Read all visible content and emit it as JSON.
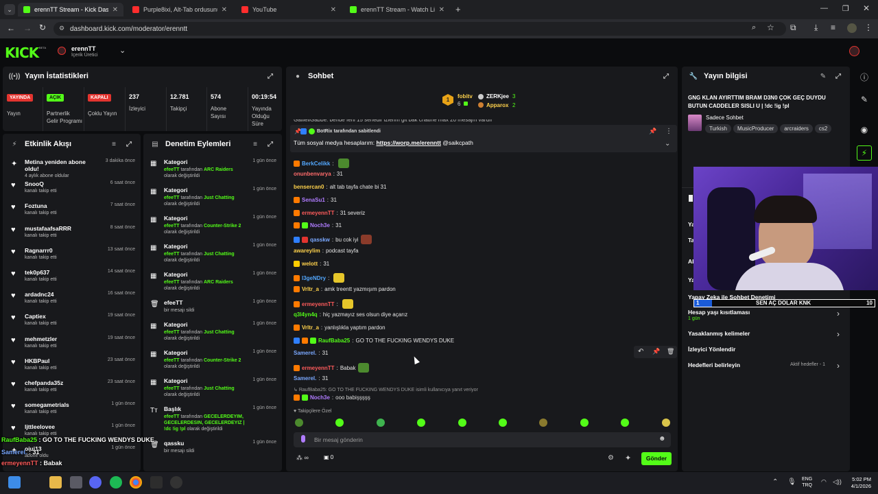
{
  "browser": {
    "tabs": [
      {
        "title": "erennTT Stream - Kick Dashboa",
        "fav": "#53fc18",
        "active": true
      },
      {
        "title": "Purple8ixi, Alt-Tab ordusunu ça",
        "fav": "#ff2d2d",
        "active": false
      },
      {
        "title": "YouTube",
        "fav": "#ff2d2d",
        "active": false
      },
      {
        "title": "erennTT Stream - Watch Live o",
        "fav": "#53fc18",
        "active": false
      }
    ],
    "url": "dashboard.kick.com/moderator/erenntt"
  },
  "header": {
    "logo": "KICK",
    "logo_beta": "BETA",
    "channel_name": "erennTT",
    "channel_role": "İçerik Üretici"
  },
  "stats": {
    "title": "Yayın İstatistikleri",
    "items": [
      {
        "badge": "YAYINDA",
        "badge_color": "#e3342f",
        "label": "Yayın"
      },
      {
        "badge": "AÇIK",
        "badge_color": "#53fc18",
        "label": "Partnerlik Gelir Programı"
      },
      {
        "badge": "KAPALI",
        "badge_color": "#e3342f",
        "label": "Çoklu Yayın"
      }
    ],
    "numbers": [
      {
        "value": "237",
        "label": "İzleyici"
      },
      {
        "value": "12.781",
        "label": "Takipçi"
      },
      {
        "value": "574",
        "label": "Abone Sayısı"
      },
      {
        "value": "00:19:54",
        "label": "Yayında Olduğu Süre"
      }
    ]
  },
  "activity": {
    "title": "Etkinlik Akışı",
    "rows": [
      {
        "name": "Metina yeniden abone oldu!",
        "sub": "4 aylık abone oldular",
        "time": "3 dakika önce",
        "icon": "star-icon"
      },
      {
        "name": "SnooQ",
        "sub": "kanalı takip etti",
        "time": "6 saat önce",
        "icon": "heart-icon"
      },
      {
        "name": "Foztuna",
        "sub": "kanalı takip etti",
        "time": "7 saat önce",
        "icon": "heart-icon"
      },
      {
        "name": "mustafaafsaRRR",
        "sub": "kanalı takip etti",
        "time": "8 saat önce",
        "icon": "heart-icon"
      },
      {
        "name": "Ragnarrr0",
        "sub": "kanalı takip etti",
        "time": "13 saat önce",
        "icon": "heart-icon"
      },
      {
        "name": "tek0p637",
        "sub": "kanalı takip etti",
        "time": "14 saat önce",
        "icon": "heart-icon"
      },
      {
        "name": "ardadnc24",
        "sub": "kanalı takip etti",
        "time": "16 saat önce",
        "icon": "heart-icon"
      },
      {
        "name": "Captiex",
        "sub": "kanalı takip etti",
        "time": "19 saat önce",
        "icon": "heart-icon"
      },
      {
        "name": "mehmetzler",
        "sub": "kanalı takip etti",
        "time": "19 saat önce",
        "icon": "heart-icon"
      },
      {
        "name": "HKBPaul",
        "sub": "kanalı takip etti",
        "time": "23 saat önce",
        "icon": "heart-icon"
      },
      {
        "name": "chefpanda35z",
        "sub": "kanalı takip etti",
        "time": "23 saat önce",
        "icon": "heart-icon"
      },
      {
        "name": "somegametrials",
        "sub": "kanalı takip etti",
        "time": "1 gün önce",
        "icon": "heart-icon"
      },
      {
        "name": "ljttleelovee",
        "sub": "kanalı takip etti",
        "time": "1 gün önce",
        "icon": "heart-icon"
      },
      {
        "name": "oiui13",
        "sub": "abone oldu",
        "time": "1 gün önce",
        "icon": "star-icon"
      }
    ]
  },
  "modlog": {
    "title": "Denetim Eylemleri",
    "rows": [
      {
        "title": "Kategori",
        "user": "efeeTT",
        "mid": " tarafından ",
        "obj": "ARC Raiders",
        "tail": " olarak değiştirildi",
        "time": "1 gün önce",
        "icon": "category-icon"
      },
      {
        "title": "Kategori",
        "user": "efeeTT",
        "mid": " tarafından ",
        "obj": "Just Chatting",
        "tail": " olarak değiştirildi",
        "time": "1 gün önce",
        "icon": "category-icon"
      },
      {
        "title": "Kategori",
        "user": "efeeTT",
        "mid": " tarafından ",
        "obj": "Counter-Strike 2",
        "tail": " olarak değiştirildi",
        "time": "1 gün önce",
        "icon": "category-icon"
      },
      {
        "title": "Kategori",
        "user": "efeeTT",
        "mid": " tarafından ",
        "obj": "Just Chatting",
        "tail": " olarak değiştirildi",
        "time": "1 gün önce",
        "icon": "category-icon"
      },
      {
        "title": "Kategori",
        "user": "efeeTT",
        "mid": " tarafından ",
        "obj": "ARC Raiders",
        "tail": " olarak değiştirildi",
        "time": "1 gün önce",
        "icon": "category-icon"
      },
      {
        "title": "efeeTT",
        "user": "",
        "mid": "bir mesajı sildi",
        "obj": "",
        "tail": "",
        "time": "1 gün önce",
        "icon": "trash-icon"
      },
      {
        "title": "Kategori",
        "user": "efeeTT",
        "mid": " tarafından ",
        "obj": "Just Chatting",
        "tail": " olarak değiştirildi",
        "time": "1 gün önce",
        "icon": "category-icon"
      },
      {
        "title": "Kategori",
        "user": "efeeTT",
        "mid": " tarafından ",
        "obj": "Counter-Strike 2",
        "tail": " olarak değiştirildi",
        "time": "1 gün önce",
        "icon": "category-icon"
      },
      {
        "title": "Kategori",
        "user": "efeeTT",
        "mid": " tarafından ",
        "obj": "Just Chatting",
        "tail": " olarak değiştirildi",
        "time": "1 gün önce",
        "icon": "category-icon"
      },
      {
        "title": "Başlık",
        "user": "efeeTT",
        "mid": " tarafından ",
        "obj": "GECELERDEYIM, GECELERDESIN, GECELERDEYIZ | !dc !ig !pl",
        "tail": " olarak değiştirildi",
        "time": "1 gün önce",
        "icon": "title-icon"
      },
      {
        "title": "qassku",
        "user": "",
        "mid": "bir mesajı sildi",
        "obj": "",
        "tail": "",
        "time": "1 gün önce",
        "icon": "trash-icon"
      }
    ]
  },
  "chat": {
    "title": "Sohbet",
    "top_gifters": [
      {
        "name": "fobitv",
        "count": "6"
      },
      {
        "name": "ZERKjee",
        "count": "3"
      },
      {
        "name": "Apparox",
        "count": "2"
      }
    ],
    "cut_line": "GalileliGabbe: bende ferii 15 senedir izlerim git bak chatine max 20 mesajm vardır",
    "pinned_by": "BotRix tarafından sabitlendi",
    "pinned_text": "Tüm sosyal medya hesaplarım: ",
    "pinned_link": "https://worp.me/erenntt",
    "pinned_tail": " @saikcpath",
    "messages": [
      {
        "user": "BerkCelikk",
        "color": "#53a8ff",
        "text": "",
        "emote": "#4c8a2e",
        "badges": [
          "#ff7a00"
        ]
      },
      {
        "user": "onunbenvarya",
        "color": "#ff6b6b",
        "text": "31",
        "badges": []
      },
      {
        "user": "bensercan0",
        "color": "#ffd24c",
        "text": "alt tab tayfa chate bi 31",
        "badges": []
      },
      {
        "user": "SenaSu1",
        "color": "#b07cff",
        "text": "31",
        "badges": [
          "#ff7a00"
        ]
      },
      {
        "user": "ermeyennTT",
        "color": "#ff5c5c",
        "text": "31 severiz",
        "badges": [
          "#ff7a00"
        ]
      },
      {
        "user": "Noch3e",
        "color": "#b07cff",
        "text": "31",
        "badges": [
          "#ff7a00",
          "#53fc18"
        ]
      },
      {
        "user": "qasskw",
        "color": "#7aa8ff",
        "text": "bu cok iyi",
        "emote": "#8a3b2a",
        "badges": [
          "#2f7fff",
          "#e3342f"
        ]
      },
      {
        "user": "awareylim",
        "color": "#ffd24c",
        "text": "podcast tayfa",
        "badges": []
      },
      {
        "user": "welott",
        "color": "#ffd24c",
        "text": "31",
        "badges": [
          "#ffcc00"
        ]
      },
      {
        "user": "l3geNDry",
        "color": "#53a8ff",
        "text": "",
        "emote": "#e6c62a",
        "badges": [
          "#ff7a00"
        ]
      },
      {
        "user": "Vrltr_a",
        "color": "#ffd24c",
        "text": "amk treentt yazmışım pardon",
        "badges": [
          "#ff7a00"
        ]
      },
      {
        "user": "ermeyennTT",
        "color": "#ff5c5c",
        "text": "",
        "emote": "#e6c62a",
        "badges": [
          "#ff7a00"
        ]
      },
      {
        "user": "q3l4yn4q",
        "color": "#53fc18",
        "text": "hiç yazmayız ses olsun diye açarız",
        "badges": []
      },
      {
        "user": "Vrltr_a",
        "color": "#ffd24c",
        "text": "yanlışlıkla yaptım pardon",
        "badges": [
          "#ff7a00"
        ]
      },
      {
        "user": "RaufBaba25",
        "color": "#53fc18",
        "text": "GO TO THE FUCKING WENDYS DUKE",
        "badges": [
          "#2f7fff",
          "#ff7a00",
          "#53fc18"
        ]
      },
      {
        "user": "Samerel.",
        "color": "#7aa8ff",
        "text": "31",
        "badges": []
      },
      {
        "user": "ermeyennTT",
        "color": "#ff5c5c",
        "text": "Babak",
        "emote": "#4c8a2e",
        "badges": [
          "#ff7a00"
        ]
      },
      {
        "user": "Samerel.",
        "color": "#7aa8ff",
        "text": "31",
        "badges": []
      }
    ],
    "reply_hint": "RaufBaba25: GO TO THE FUCKING WENDYS DUKE isimli kullanıcıya yanıt veriyor",
    "reply_user": "Noch3e",
    "reply_text": "ooo babişşşşş",
    "emote_group": "Takipçilere Özel",
    "input_placeholder": "Bir mesaj gönderin",
    "points": "∞",
    "gift_count": "0",
    "send_label": "Gönder"
  },
  "stream_info": {
    "title": "Yayın bilgisi",
    "stream_title": "GNG KLAN AYIRTTIM BRAM D3N0 ÇOK GEÇ DUYDU BUTUN CADDELER SISLI U | !dc !ig !pl",
    "chat_mode": "Sadece Sohbet",
    "tags": [
      "Turkish",
      "MusicProducer",
      "arcraiders",
      "cs2"
    ],
    "rows": [
      {
        "label": "Yapay Zeka ile Sohbet Denetimi",
        "sub": "",
        "right": ""
      },
      {
        "label": "Hesap yaşı kısıtlaması",
        "sub": "1 gün",
        "right": ""
      },
      {
        "label": "Yasaklanmış kelimeler",
        "sub": "",
        "right": ""
      },
      {
        "label": "İzleyici Yönlendir",
        "sub": "",
        "right": ""
      },
      {
        "label": "Hedefleri belirleyin",
        "sub": "",
        "right": "Aktif hedefler - 1"
      }
    ],
    "cut_labels": [
      "Ya",
      "Ta",
      "Al",
      "Ya"
    ]
  },
  "goal_bar": {
    "left": "1",
    "text": "SEN AÇ DOLAR KNK",
    "right": "10",
    "fill_fraction": 0.1
  },
  "overlay_chat": [
    {
      "user": "RaufBaba25",
      "color": "#53fc18",
      "text": " : GO TO THE FUCKING WENDYS DUKE"
    },
    {
      "user": "Samerel.",
      "color": "#7aa8ff",
      "text": " : 31"
    },
    {
      "user": "ermeyennTT",
      "color": "#ff5c5c",
      "text": " : Babak"
    },
    {
      "user": "Samerel.",
      "color": "#7aa8ff",
      "text": " : 31"
    },
    {
      "user": "Noch3e",
      "color": "#b07cff",
      "text": " : ooo babişşşşş"
    }
  ],
  "taskbar": {
    "lang1": "ENG",
    "lang2": "TRQ",
    "time": "5:02 PM",
    "date": "4/1/2026"
  }
}
